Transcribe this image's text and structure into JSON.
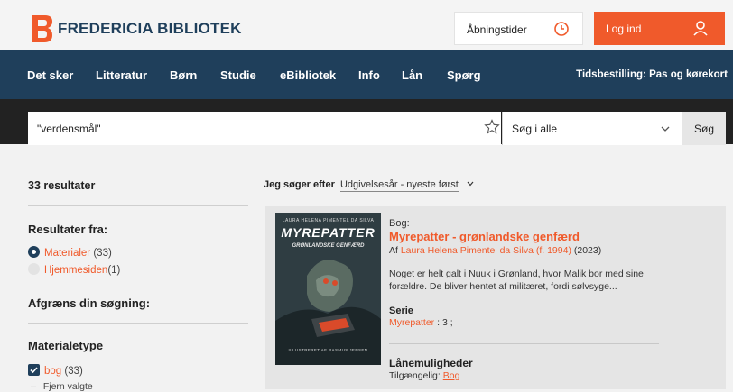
{
  "header": {
    "brand": "FREDERICIA BIBLIOTEK",
    "hours_label": "Åbningstider",
    "login_label": "Log ind",
    "accent_color": "#f05a2b",
    "navy_color": "#1f3f5b"
  },
  "nav": {
    "items": [
      "Det sker",
      "Litteratur",
      "Børn",
      "Studie",
      "eBibliotek",
      "Info",
      "Lån",
      "Spørg"
    ],
    "right_link": "Tidsbestilling: Pas og kørekort"
  },
  "search": {
    "query": "\"verdensmål\"",
    "scope": "Søg i alle",
    "button": "Søg"
  },
  "sidebar": {
    "result_count": "33 resultater",
    "results_from_title": "Resultater fra:",
    "results_from": [
      {
        "label": "Materialer",
        "count": "(33)",
        "selected": true
      },
      {
        "label": "Hjemmesiden",
        "count": "(1)",
        "selected": false
      }
    ],
    "narrow_title": "Afgræns din søgning:",
    "material_type_title": "Materialetype",
    "material_types": [
      {
        "label": "bog",
        "count": "(33)",
        "checked": true
      }
    ],
    "clear_label": "Fjern valgte"
  },
  "sort": {
    "label": "Jeg søger efter",
    "value": "Udgivelsesår - nyeste først"
  },
  "result": {
    "type": "Bog:",
    "title": "Myrepatter - grønlandske genfærd",
    "author_prefix": "Af",
    "author": "Laura Helena Pimentel da Silva (f. 1994)",
    "year": "(2023)",
    "description": "Noget er helt galt i Nuuk i Grønland, hvor Malik bor med sine forældre. De bliver hentet af militæret, fordi sølvsyge...",
    "series_title": "Serie",
    "series_link": "Myrepatter",
    "series_suffix": ": 3 ;",
    "loan_title": "Lånemuligheder",
    "available_label": "Tilgængelig:",
    "available_link": "Bog",
    "cover": {
      "top_text": "LAURA HELENA PIMENTEL DA SILVA",
      "title": "MYREPATTER",
      "subtitle": "GRØNLANDSKE GENFÆRD",
      "bottom_text": "ILLUSTRERET AF RASMUS JENSEN"
    }
  }
}
